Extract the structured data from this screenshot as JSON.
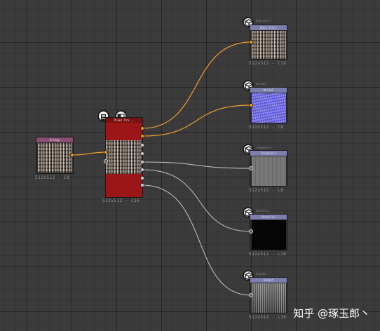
{
  "canvas": {
    "background": "#3b3b3b",
    "link_orange": "#f0a030",
    "link_grey": "#c8c8c8"
  },
  "bitmap_node": {
    "title": "Bitmap",
    "resolution": "512x512 - C8",
    "header_color": "#8a4f72"
  },
  "multi_node": {
    "title": "Pixel Pro...",
    "resolution": "512x512 - C16",
    "body_color": "#9b1616",
    "icons": [
      "document-icon",
      "checker-icon"
    ]
  },
  "outputs": [
    {
      "key": "basecolor",
      "top_label": "basecolor",
      "title": "Base Color",
      "resolution": "512x512 - C16",
      "header_color": "#7c7fae",
      "texture": "fibers",
      "icon": "cube-icon"
    },
    {
      "key": "normal",
      "top_label": "normal",
      "title": "Normal",
      "resolution": "512x512 - C8",
      "header_color": "#7c7fae",
      "texture": "normal",
      "icon": "cube-icon"
    },
    {
      "key": "roughness",
      "top_label": "roughness",
      "title": "Roughness",
      "resolution": "512x512 - L8",
      "header_color": "#7c7fae",
      "texture": "noise",
      "icon": "cube-icon"
    },
    {
      "key": "metallic",
      "top_label": "metallic",
      "title": "Metallic",
      "resolution": "512x512 - L16",
      "header_color": "#7c7fae",
      "texture": "black",
      "icon": "cube-icon"
    },
    {
      "key": "height",
      "top_label": "height",
      "title": "Height",
      "resolution": "512x512 - L16",
      "header_color": "#7c7fae",
      "texture": "height",
      "icon": "cube-icon"
    }
  ],
  "watermark": "知乎 @琢玉郎丶"
}
